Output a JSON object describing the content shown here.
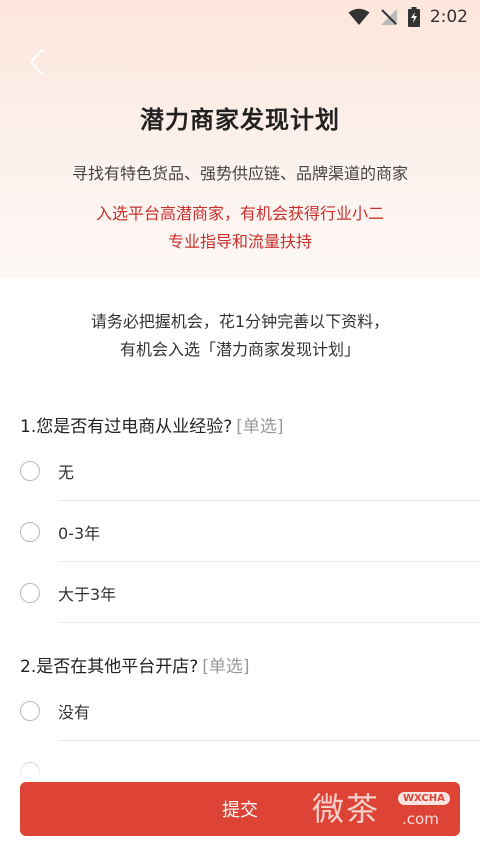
{
  "status_bar": {
    "time": "2:02",
    "icons": [
      "wifi-icon",
      "no-signal-icon",
      "battery-charging-icon"
    ]
  },
  "header": {
    "back_icon": "chevron-left-icon",
    "title": "潜力商家发现计划",
    "subtitle": "寻找有特色货品、强势供应链、品牌渠道的商家",
    "highlight_line1": "入选平台高潜商家，有机会获得行业小二",
    "highlight_line2": "专业指导和流量扶持"
  },
  "intro": {
    "line1": "请务必把握机会，花1分钟完善以下资料，",
    "line2": "有机会入选「潜力商家发现计划」"
  },
  "questions": [
    {
      "title": "1.您是否有过电商从业经验?",
      "tag": "[单选]",
      "options": [
        "无",
        "0-3年",
        "大于3年"
      ]
    },
    {
      "title": "2.是否在其他平台开店?",
      "tag": "[单选]",
      "options": [
        "没有"
      ]
    }
  ],
  "submit_label": "提交",
  "watermark": {
    "cn": "微茶",
    "badge": "WXCHA",
    "domain": ".com"
  },
  "colors": {
    "accent": "#dd4436",
    "highlight_text": "#c9302c",
    "hero_bg": "#fde6dc"
  }
}
